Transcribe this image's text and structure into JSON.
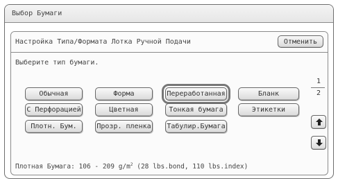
{
  "window": {
    "title": "Выбор Бумаги"
  },
  "panel": {
    "title": "Настройка Типа/Формата Лотка Ручной Подачи",
    "cancel_label": "Отменить",
    "prompt": "Выберите тип бумаги."
  },
  "paper_types": [
    {
      "label": "Обычная",
      "selected": false
    },
    {
      "label": "Форма",
      "selected": false
    },
    {
      "label": "Переработанная",
      "selected": true
    },
    {
      "label": "Бланк",
      "selected": false
    },
    {
      "label": "С Перфорацией",
      "selected": false
    },
    {
      "label": "Цветная",
      "selected": false
    },
    {
      "label": "Тонкая бумага",
      "selected": false
    },
    {
      "label": "Этикетки",
      "selected": false
    },
    {
      "label": "Плотн. Бум.",
      "selected": false
    },
    {
      "label": "Прозр. пленка",
      "selected": false
    },
    {
      "label": "Табулир.Бумага",
      "selected": false
    }
  ],
  "pager": {
    "current": "1",
    "total": "2",
    "up_icon": "arrow-up-icon",
    "down_icon": "arrow-down-icon"
  },
  "note": {
    "prefix": "Плотная Бумага: 106 - 209 g/m",
    "superscript": "2",
    "suffix": " (28 lbs.bond, 110 lbs.index)"
  }
}
